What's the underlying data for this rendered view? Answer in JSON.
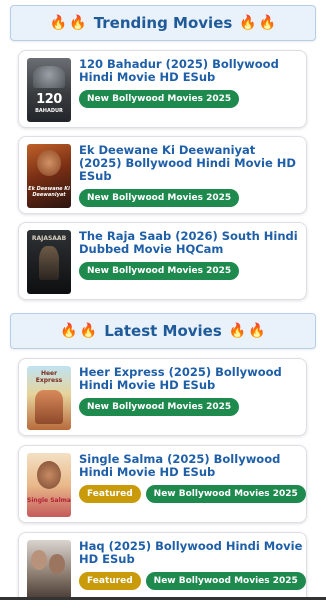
{
  "trending": {
    "title": "Trending Movies",
    "fire_icon": "🔥",
    "items": [
      {
        "title": "120 Bahadur (2025) Bollywood Hindi Movie HD ESub",
        "badges": [
          "New Bollywood Movies 2025"
        ],
        "poster_text": "120",
        "poster_sub": "BAHADUR"
      },
      {
        "title": "Ek Deewane Ki Deewaniyat (2025) Bollywood Hindi Movie HD ESub",
        "badges": [
          "New Bollywood Movies 2025"
        ],
        "poster_text": "Ek Deewane Ki Deewaniyat"
      },
      {
        "title": "The Raja Saab (2026) South Hindi Dubbed Movie HQCam",
        "badges": [
          "New Bollywood Movies 2025"
        ],
        "poster_text": "RAJASAAB"
      }
    ]
  },
  "latest": {
    "title": "Latest Movies",
    "fire_icon": "🔥",
    "items": [
      {
        "title": "Heer Express (2025) Bollywood Hindi Movie HD ESub",
        "badges": [
          "New Bollywood Movies 2025"
        ],
        "poster_text": "Heer Express"
      },
      {
        "title": "Single Salma (2025) Bollywood Hindi Movie HD ESub",
        "featured": "Featured",
        "badges": [
          "New Bollywood Movies 2025"
        ],
        "poster_text": "Single Salma"
      },
      {
        "title": "Haq (2025) Bollywood Hindi Movie HD ESub",
        "featured": "Featured",
        "badges": [
          "New Bollywood Movies 2025"
        ],
        "poster_text": ""
      }
    ]
  },
  "colors": {
    "accent": "#1f5a99",
    "badge_green": "#1e8a4e",
    "badge_gold": "#c99a09",
    "link": "#1f5fa8"
  }
}
